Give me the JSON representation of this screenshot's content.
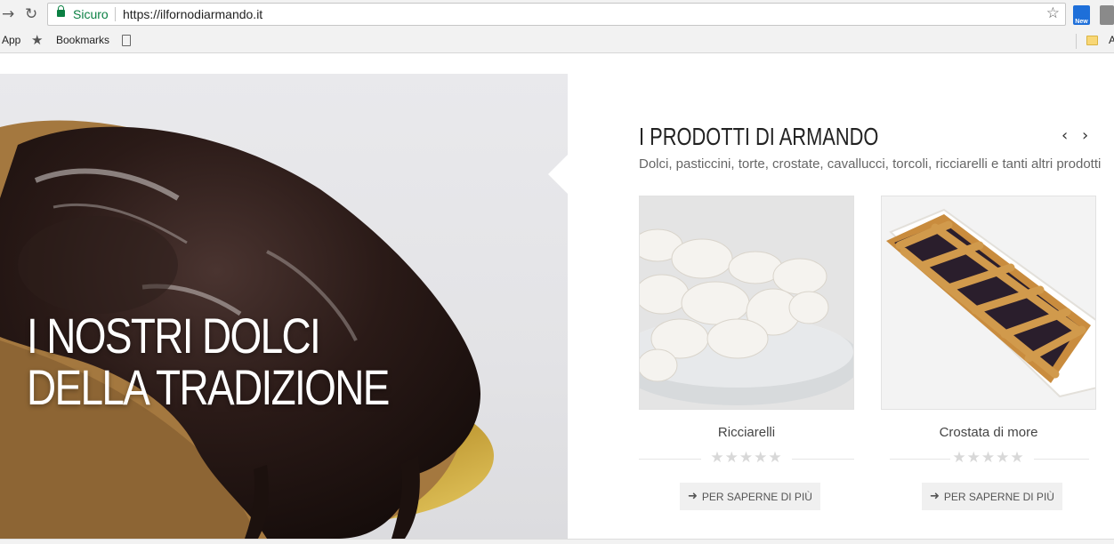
{
  "browser": {
    "secure_label": "Sicuro",
    "url": "https://ilfornodiarmando.it",
    "ext_badge": "New",
    "bookmarks": {
      "apps": "App",
      "bookmarks": "Bookmarks",
      "overflow": "A"
    }
  },
  "hero": {
    "title_line1": "I NOSTRI DOLCI",
    "title_line2": "DELLA TRADIZIONE"
  },
  "products_section": {
    "title": "I PRODOTTI DI ARMANDO",
    "subtitle": "Dolci, pasticcini, torte, crostate, cavallucci, torcoli, ricciarelli e tanti altri prodotti",
    "prev_arrow": "‹",
    "next_arrow": "›",
    "products": [
      {
        "name": "Ricciarelli",
        "rating": 0,
        "stars": "★★★★★",
        "button_label": "PER SAPERNE DI PIÙ"
      },
      {
        "name": "Crostata di more",
        "rating": 0,
        "stars": "★★★★★",
        "button_label": "PER SAPERNE DI PIÙ"
      }
    ]
  },
  "colors": {
    "secure_green": "#0b8043",
    "button_bg": "#f0f0f0",
    "star_empty": "#d8d8d8"
  }
}
